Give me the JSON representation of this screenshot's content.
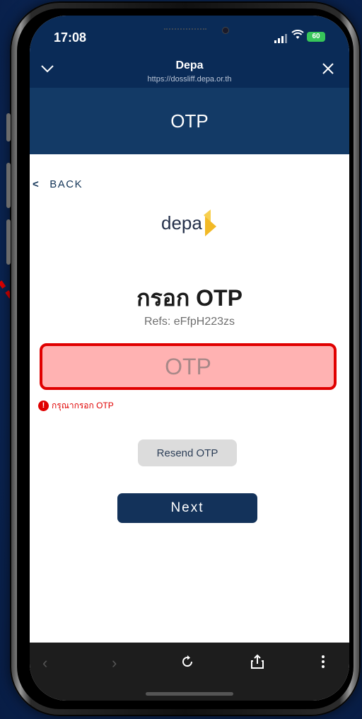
{
  "status_bar": {
    "time": "17:08",
    "battery": "60"
  },
  "browser": {
    "title": "Depa",
    "url": "https://dossliff.depa.or.th",
    "collapse_icon": "chevron-down-icon",
    "close_icon": "close-icon"
  },
  "header": {
    "title": "OTP"
  },
  "back": {
    "label": "BACK"
  },
  "logo": {
    "text": "depa"
  },
  "form": {
    "title": "กรอก OTP",
    "refs": "Refs: eFfpH223zs",
    "otp_placeholder": "OTP",
    "otp_value": "",
    "error": "กรุณากรอก OTP",
    "resend_label": "Resend OTP",
    "next_label": "Next"
  },
  "colors": {
    "header_bg": "#133a66",
    "error": "#e00000",
    "highlight_fill": "#ffb2b2",
    "next_bg": "#13325a"
  }
}
